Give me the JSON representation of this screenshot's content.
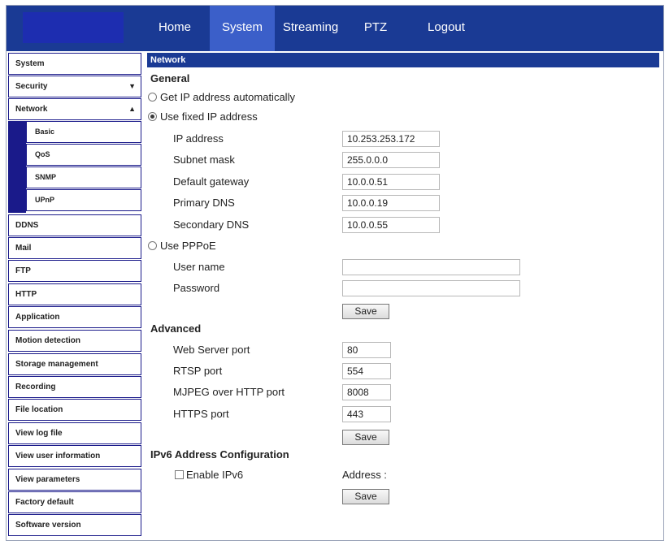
{
  "nav": {
    "tabs": [
      {
        "label": "Home",
        "active": false
      },
      {
        "label": "System",
        "active": true
      },
      {
        "label": "Streaming",
        "active": false
      },
      {
        "label": "PTZ",
        "active": false
      },
      {
        "label": "Logout",
        "active": false
      }
    ]
  },
  "sidebar": {
    "items": [
      {
        "label": "System"
      },
      {
        "label": "Security",
        "arrow": "▼"
      },
      {
        "label": "Network",
        "arrow": "▲"
      },
      {
        "label": "DDNS"
      },
      {
        "label": "Mail"
      },
      {
        "label": "FTP"
      },
      {
        "label": "HTTP"
      },
      {
        "label": "Application"
      },
      {
        "label": "Motion detection"
      },
      {
        "label": "Storage management"
      },
      {
        "label": "Recording"
      },
      {
        "label": "File location"
      },
      {
        "label": "View log file"
      },
      {
        "label": "View user information"
      },
      {
        "label": "View parameters"
      },
      {
        "label": "Factory default"
      },
      {
        "label": "Software version"
      }
    ],
    "network_sub": [
      {
        "label": "Basic"
      },
      {
        "label": "QoS"
      },
      {
        "label": "SNMP"
      },
      {
        "label": "UPnP"
      }
    ]
  },
  "main": {
    "section_title": "Network",
    "general_heading": "General",
    "radio_auto": "Get IP address automatically",
    "radio_fixed": "Use fixed IP address",
    "fixed": {
      "ip_label": "IP address",
      "ip_value": "10.253.253.172",
      "subnet_label": "Subnet mask",
      "subnet_value": "255.0.0.0",
      "gateway_label": "Default gateway",
      "gateway_value": "10.0.0.51",
      "dns1_label": "Primary DNS",
      "dns1_value": "10.0.0.19",
      "dns2_label": "Secondary DNS",
      "dns2_value": "10.0.0.55"
    },
    "radio_pppoe": "Use PPPoE",
    "pppoe": {
      "user_label": "User name",
      "user_value": "",
      "pass_label": "Password",
      "pass_value": ""
    },
    "save_label": "Save",
    "advanced_heading": "Advanced",
    "advanced": {
      "web_label": "Web Server port",
      "web_value": "80",
      "rtsp_label": "RTSP port",
      "rtsp_value": "554",
      "mjpeg_label": "MJPEG over HTTP port",
      "mjpeg_value": "8008",
      "https_label": "HTTPS port",
      "https_value": "443"
    },
    "ipv6_heading": "IPv6 Address Configuration",
    "ipv6_enable_label": "Enable IPv6",
    "ipv6_address_label": "Address :"
  }
}
